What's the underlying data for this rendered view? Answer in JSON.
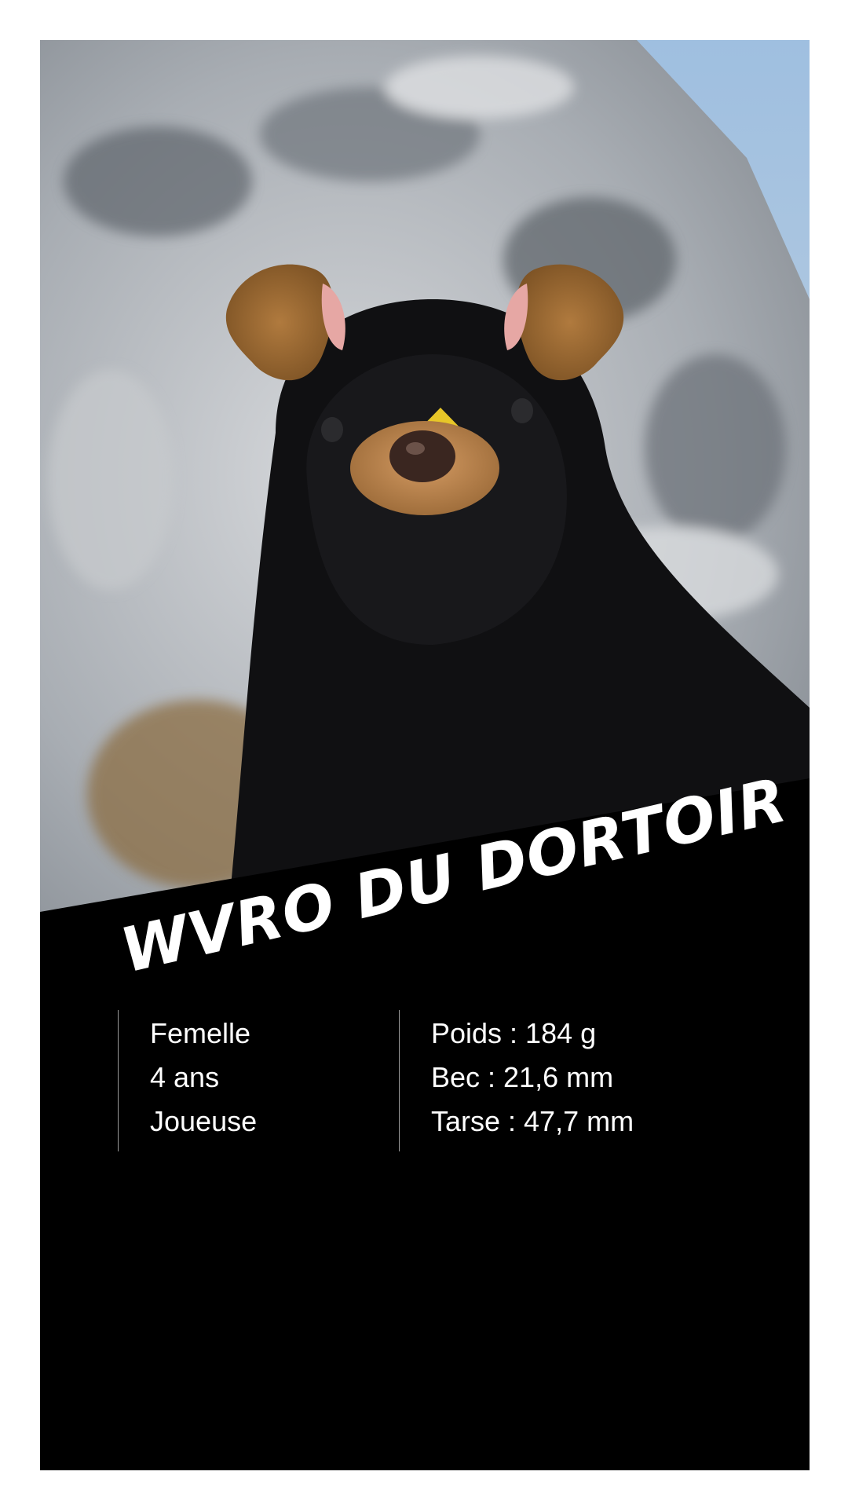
{
  "card": {
    "name": "WVRO DU DORTOIR",
    "traits": [
      "Femelle",
      "4 ans",
      "Joueuse"
    ],
    "measurements": [
      "Poids : 184 g",
      "Bec : 21,6 mm",
      "Tarse : 47,7 mm"
    ]
  },
  "colors": {
    "background": "#ffffff",
    "panel": "#000000",
    "text": "#ffffff",
    "divider": "#9a9a9a"
  }
}
